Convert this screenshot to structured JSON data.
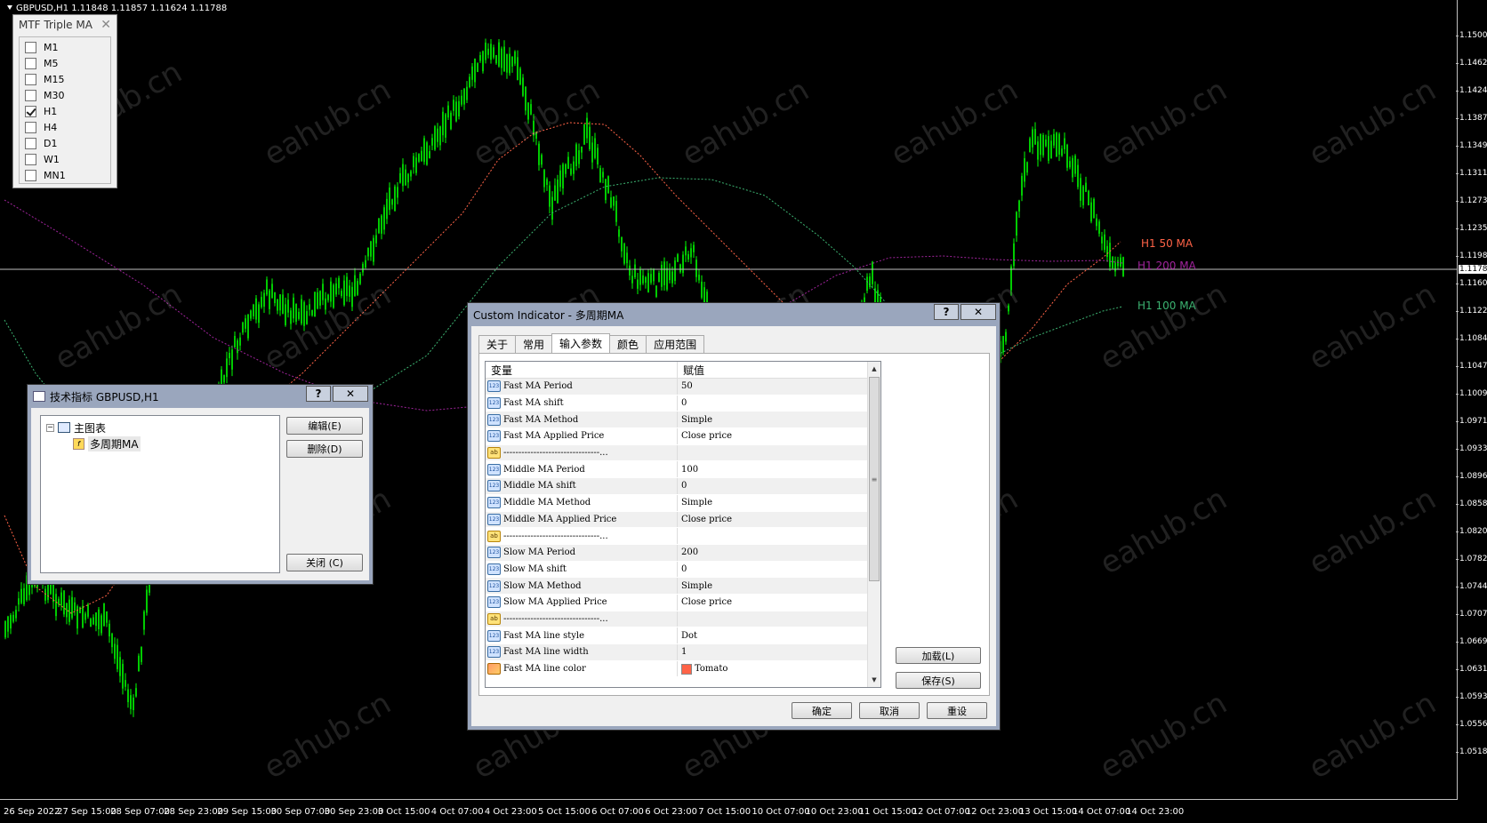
{
  "chart": {
    "symbol_title": "GBPUSD,H1  1.11848 1.11857 1.11624 1.11788",
    "current_price": "1.1178",
    "price_ticks": [
      "1.1500",
      "1.1462",
      "1.1424",
      "1.1387",
      "1.1349",
      "1.1311",
      "1.1273",
      "1.1235",
      "1.1198",
      "1.1160",
      "1.1122",
      "1.1084",
      "1.1047",
      "1.1009",
      "1.0971",
      "1.0933",
      "1.0896",
      "1.0858",
      "1.0820",
      "1.0782",
      "1.0744",
      "1.0707",
      "1.0669",
      "1.0631",
      "1.0593",
      "1.0556",
      "1.0518"
    ],
    "time_ticks": [
      "26 Sep 2022",
      "27 Sep 15:00",
      "28 Sep 07:00",
      "28 Sep 23:00",
      "29 Sep 15:00",
      "30 Sep 07:00",
      "30 Sep 23:00",
      "3 Oct 15:00",
      "4 Oct 07:00",
      "4 Oct 23:00",
      "5 Oct 15:00",
      "6 Oct 07:00",
      "6 Oct 23:00",
      "7 Oct 15:00",
      "10 Oct 07:00",
      "10 Oct 23:00",
      "11 Oct 15:00",
      "12 Oct 07:00",
      "12 Oct 23:00",
      "13 Oct 15:00",
      "14 Oct 07:00",
      "14 Oct 23:00"
    ],
    "ma_labels": [
      {
        "text": "H1 50 MA",
        "color": "#FF6347"
      },
      {
        "text": "H1 200 MA",
        "color": "#A0249C"
      },
      {
        "text": "H1 100 MA",
        "color": "#3CB371"
      }
    ],
    "candle_color": "#00FF00",
    "watermark": "eahub.cn"
  },
  "mtf_panel": {
    "title": "MTF Triple MA",
    "close": "✕",
    "items": [
      {
        "label": "M1",
        "checked": false
      },
      {
        "label": "M5",
        "checked": false
      },
      {
        "label": "M15",
        "checked": false
      },
      {
        "label": "M30",
        "checked": false
      },
      {
        "label": "H1",
        "checked": true
      },
      {
        "label": "H4",
        "checked": false
      },
      {
        "label": "D1",
        "checked": false
      },
      {
        "label": "W1",
        "checked": false
      },
      {
        "label": "MN1",
        "checked": false
      }
    ]
  },
  "indicators_dialog": {
    "title": "技术指标 GBPUSD,H1",
    "help": "?",
    "close": "✕",
    "tree_root": "主图表",
    "tree_child": "多周期MA",
    "edit_button": "编辑(E)",
    "delete_button": "删除(D)",
    "close_button": "关闭 (C)"
  },
  "custom_dialog": {
    "title": "Custom Indicator - 多周期MA",
    "help": "?",
    "close": "✕",
    "tabs": [
      "关于",
      "常用",
      "输入参数",
      "颜色",
      "应用范围"
    ],
    "active_tab": 2,
    "col_variable": "变量",
    "col_value": "赋值",
    "rows": [
      {
        "type": "num",
        "name": "Fast MA Period",
        "value": "50"
      },
      {
        "type": "num",
        "name": "Fast MA shift",
        "value": "0"
      },
      {
        "type": "num",
        "name": "Fast MA Method",
        "value": "Simple"
      },
      {
        "type": "num",
        "name": "Fast MA Applied Price",
        "value": "Close price"
      },
      {
        "type": "ab",
        "name": "--------------------------------...",
        "value": ""
      },
      {
        "type": "num",
        "name": "Middle MA Period",
        "value": "100"
      },
      {
        "type": "num",
        "name": "Middle MA shift",
        "value": "0"
      },
      {
        "type": "num",
        "name": "Middle MA Method",
        "value": "Simple"
      },
      {
        "type": "num",
        "name": "Middle MA Applied Price",
        "value": "Close price"
      },
      {
        "type": "ab",
        "name": "--------------------------------...",
        "value": ""
      },
      {
        "type": "num",
        "name": "Slow MA Period",
        "value": "200"
      },
      {
        "type": "num",
        "name": "Slow MA shift",
        "value": "0"
      },
      {
        "type": "num",
        "name": "Slow MA Method",
        "value": "Simple"
      },
      {
        "type": "num",
        "name": "Slow MA Applied Price",
        "value": "Close price"
      },
      {
        "type": "ab",
        "name": "--------------------------------...",
        "value": ""
      },
      {
        "type": "num",
        "name": "Fast MA line style",
        "value": "Dot"
      },
      {
        "type": "num",
        "name": "Fast MA line width",
        "value": "1"
      },
      {
        "type": "clr",
        "name": "Fast MA line color",
        "value": "Tomato",
        "swatch": "#FF6347"
      }
    ],
    "load_button": "加载(L)",
    "save_button": "保存(S)",
    "ok_button": "确定",
    "cancel_button": "取消",
    "reset_button": "重设"
  }
}
